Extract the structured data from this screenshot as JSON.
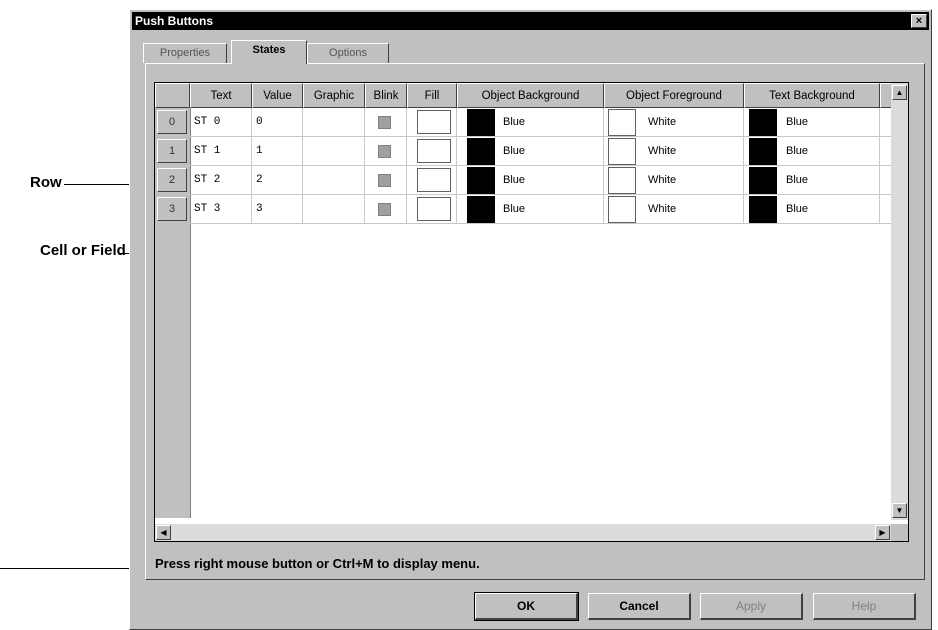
{
  "annotations": {
    "row": "Row",
    "cell_or_field": "Cell or Field"
  },
  "dialog": {
    "title": "Push Buttons",
    "close_glyph": "×"
  },
  "tabs": [
    {
      "label": "Properties",
      "active": false
    },
    {
      "label": "States",
      "active": true
    },
    {
      "label": "Options",
      "active": false
    }
  ],
  "grid": {
    "columns": [
      "Text",
      "Value",
      "Graphic",
      "Blink",
      "Fill",
      "Object Background",
      "Object Foreground",
      "Text Background"
    ],
    "rows": [
      {
        "index": "0",
        "text": "ST 0",
        "value": "0",
        "graphic": "",
        "obj_bg": "Blue",
        "obj_fg": "White",
        "text_bg": "Blue"
      },
      {
        "index": "1",
        "text": "ST 1",
        "value": "1",
        "graphic": "",
        "obj_bg": "Blue",
        "obj_fg": "White",
        "text_bg": "Blue"
      },
      {
        "index": "2",
        "text": "ST 2",
        "value": "2",
        "graphic": "",
        "obj_bg": "Blue",
        "obj_fg": "White",
        "text_bg": "Blue"
      },
      {
        "index": "3",
        "text": "ST 3",
        "value": "3",
        "graphic": "",
        "obj_bg": "Blue",
        "obj_fg": "White",
        "text_bg": "Blue"
      }
    ]
  },
  "status_text": "Press right mouse button or Ctrl+M to display menu.",
  "buttons": {
    "ok": "OK",
    "cancel": "Cancel",
    "apply": "Apply",
    "help": "Help"
  },
  "colors": {
    "dialog_face": "#c0c0c0",
    "title_bar": "#000000",
    "swatch_blue_shown_as": "#000000",
    "swatch_white": "#ffffff"
  }
}
